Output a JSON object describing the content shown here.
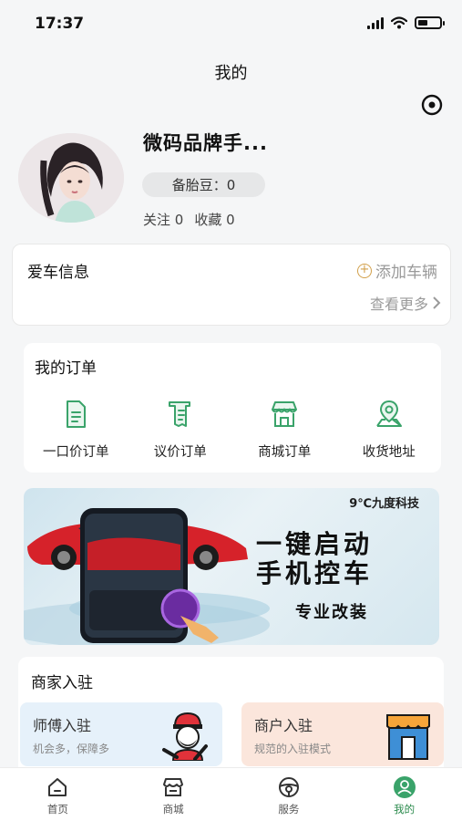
{
  "status_bar": {
    "time": "17:37",
    "battery_level": 0.45
  },
  "header": {
    "title": "我的"
  },
  "profile": {
    "nickname": "微码品牌手...",
    "beans": "备胎豆：0",
    "following": "关注 0",
    "favorites": "收藏 0"
  },
  "car_info": {
    "title": "爱车信息",
    "add_label": "添加车辆",
    "more_label": "查看更多"
  },
  "orders": {
    "title": "我的订单",
    "items": [
      {
        "label": "一口价订单",
        "icon": "document-icon"
      },
      {
        "label": "议价订单",
        "icon": "receipt-icon"
      },
      {
        "label": "商城订单",
        "icon": "store-icon"
      },
      {
        "label": "收货地址",
        "icon": "location-icon"
      }
    ]
  },
  "banner": {
    "brand": "9℃九度科技",
    "line1": "一键启动",
    "line2": "手机控车",
    "line3": "专业改装"
  },
  "merchant": {
    "title": "商家入驻",
    "master": {
      "title": "师傅入驻",
      "subtitle": "机会多，保障多"
    },
    "shop": {
      "title": "商户入驻",
      "subtitle": "规范的入驻模式"
    }
  },
  "tabs": [
    {
      "label": "首页",
      "icon": "home-icon"
    },
    {
      "label": "商城",
      "icon": "shop-icon"
    },
    {
      "label": "服务",
      "icon": "steering-wheel-icon"
    },
    {
      "label": "我的",
      "icon": "user-icon",
      "active": true
    }
  ],
  "colors": {
    "accent": "#2a8a4c",
    "icon_green": "#3aa36a",
    "background": "#f5f6f7"
  }
}
